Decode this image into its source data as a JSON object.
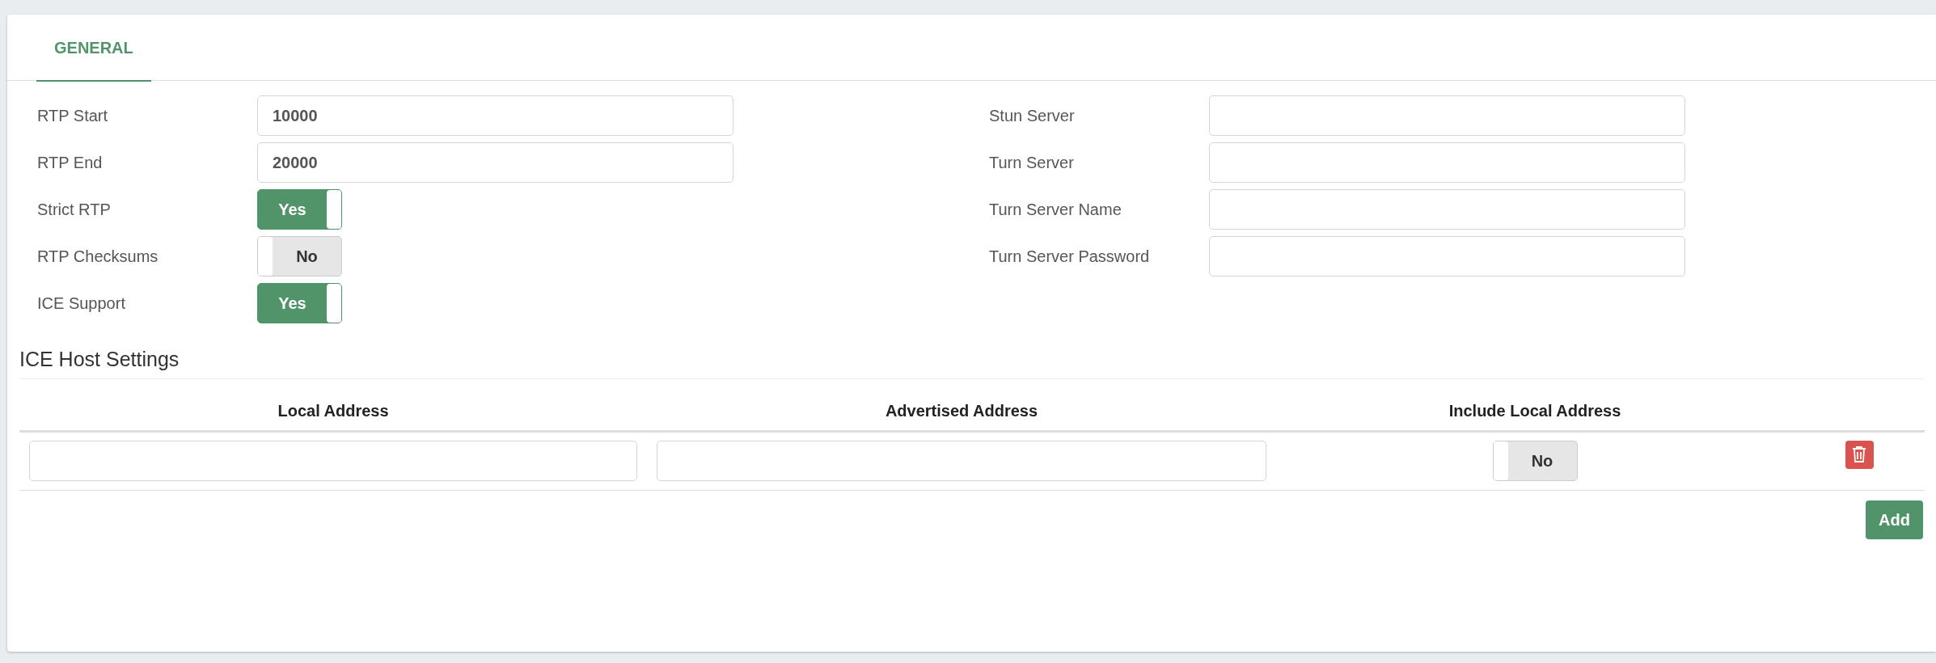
{
  "tabs": [
    {
      "label": "GENERAL",
      "selected": true
    }
  ],
  "left_fields": [
    {
      "kind": "text",
      "label": "RTP Start",
      "value": "10000"
    },
    {
      "kind": "text",
      "label": "RTP End",
      "value": "20000"
    },
    {
      "kind": "toggle",
      "label": "Strict RTP",
      "on": true,
      "toggle_text": "Yes"
    },
    {
      "kind": "toggle",
      "label": "RTP Checksums",
      "on": false,
      "toggle_text": "No"
    },
    {
      "kind": "toggle",
      "label": "ICE Support",
      "on": true,
      "toggle_text": "Yes"
    }
  ],
  "right_fields": [
    {
      "kind": "text",
      "label": "Stun Server"
    },
    {
      "kind": "text",
      "label": "Turn Server"
    },
    {
      "kind": "text",
      "label": "Turn Server Name"
    },
    {
      "kind": "text",
      "label": "Turn Server Password"
    }
  ],
  "ice_hosts": {
    "title": "ICE Host Settings",
    "columns": [
      "Local Address",
      "Advertised Address",
      "Include Local Address"
    ],
    "rows": [
      {
        "include_local_on": false,
        "include_local_text": "No"
      }
    ],
    "add_button": "Add"
  }
}
